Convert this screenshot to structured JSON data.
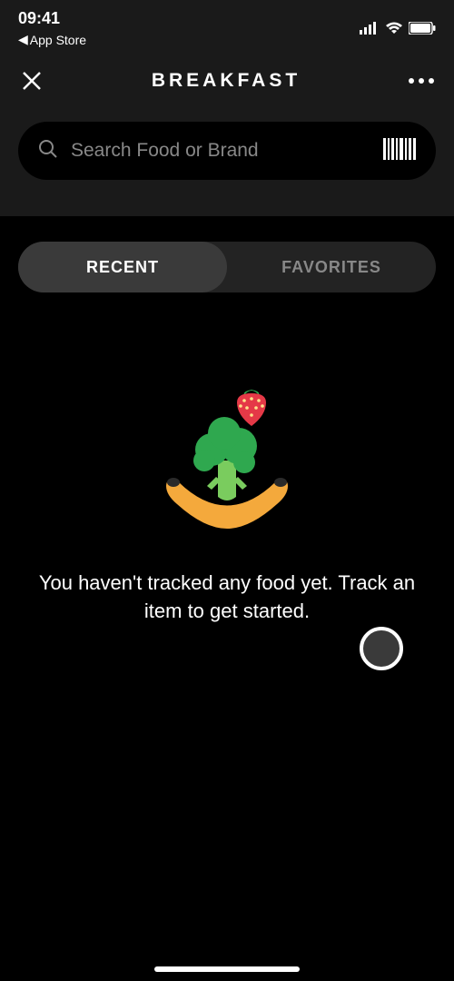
{
  "status": {
    "time": "09:41",
    "back_app": "App Store"
  },
  "header": {
    "title": "BREAKFAST"
  },
  "search": {
    "placeholder": "Search Food or Brand"
  },
  "tabs": {
    "recent": "RECENT",
    "favorites": "FAVORITES",
    "active": "recent"
  },
  "empty": {
    "message": "You haven't tracked any food yet. Track an item to get started."
  }
}
